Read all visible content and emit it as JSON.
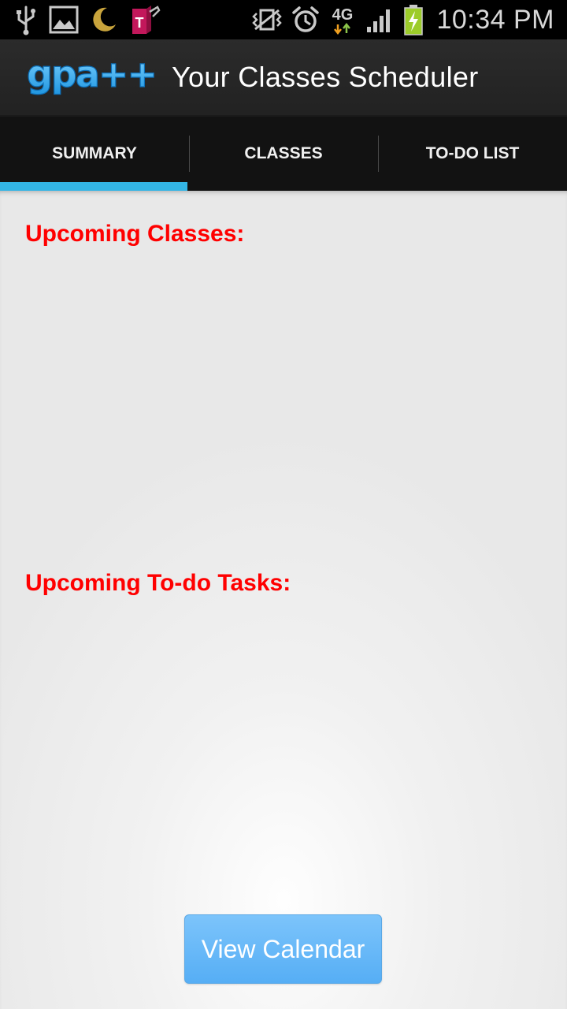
{
  "status_bar": {
    "left_icons": [
      "usb-icon",
      "image-icon",
      "moon-icon",
      "t-mobile-icon"
    ],
    "right_icons": [
      "vibrate-icon",
      "alarm-icon",
      "4g-icon",
      "signal-icon",
      "battery-charging-icon"
    ],
    "network_type": "4G",
    "carrier_badge": "T",
    "time": "10:34 PM"
  },
  "action_bar": {
    "logo_text": "gpa++",
    "title": "Your Classes Scheduler"
  },
  "tabs": [
    {
      "label": "SUMMARY",
      "active": true
    },
    {
      "label": "CLASSES",
      "active": false
    },
    {
      "label": "TO-DO LIST",
      "active": false
    }
  ],
  "summary": {
    "upcoming_classes_heading": "Upcoming Classes:",
    "upcoming_classes": [],
    "upcoming_tasks_heading": "Upcoming To-do Tasks:",
    "upcoming_tasks": [],
    "view_calendar_label": "View Calendar"
  },
  "colors": {
    "accent_tab_indicator": "#33b5e5",
    "heading_red": "#ff0000",
    "button_blue": "#5fb4f7",
    "logo_blue": "#3fb0f0"
  }
}
